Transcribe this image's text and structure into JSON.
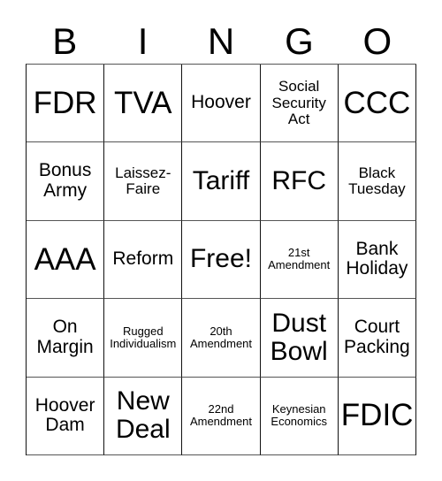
{
  "card": {
    "headers": [
      "B",
      "I",
      "N",
      "G",
      "O"
    ],
    "rows": [
      [
        {
          "text": "FDR",
          "size": "xl"
        },
        {
          "text": "TVA",
          "size": "xl"
        },
        {
          "text": "Hoover",
          "size": "md"
        },
        {
          "text": "Social Security Act",
          "size": "sm"
        },
        {
          "text": "CCC",
          "size": "xl"
        }
      ],
      [
        {
          "text": "Bonus Army",
          "size": "md"
        },
        {
          "text": "Laissez-Faire",
          "size": "sm"
        },
        {
          "text": "Tariff",
          "size": "lg"
        },
        {
          "text": "RFC",
          "size": "lg"
        },
        {
          "text": "Black Tuesday",
          "size": "sm"
        }
      ],
      [
        {
          "text": "AAA",
          "size": "xl"
        },
        {
          "text": "Reform",
          "size": "md"
        },
        {
          "text": "Free!",
          "size": "lg"
        },
        {
          "text": "21st Amendment",
          "size": "xs"
        },
        {
          "text": "Bank Holiday",
          "size": "md"
        }
      ],
      [
        {
          "text": "On Margin",
          "size": "md"
        },
        {
          "text": "Rugged Individualism",
          "size": "xs"
        },
        {
          "text": "20th Amendment",
          "size": "xs"
        },
        {
          "text": "Dust Bowl",
          "size": "lg"
        },
        {
          "text": "Court Packing",
          "size": "md"
        }
      ],
      [
        {
          "text": "Hoover Dam",
          "size": "md"
        },
        {
          "text": "New Deal",
          "size": "lg"
        },
        {
          "text": "22nd Amendment",
          "size": "xs"
        },
        {
          "text": "Keynesian Economics",
          "size": "xs"
        },
        {
          "text": "FDIC",
          "size": "xl"
        }
      ]
    ],
    "free_space": {
      "row": 2,
      "col": 2,
      "label": "Free!"
    }
  },
  "colors": {
    "background": "#ffffff",
    "text": "#000000",
    "grid_line": "#111111"
  }
}
